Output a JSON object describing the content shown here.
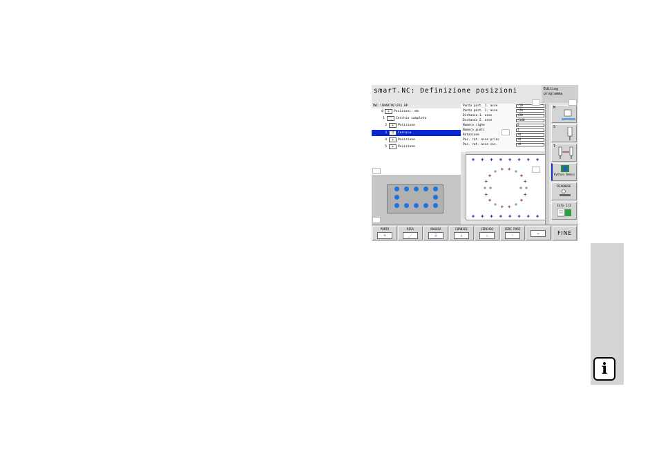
{
  "window": {
    "title": "smarT.NC: Definizione posizioni",
    "mode_line1": "Editing",
    "mode_line2": "programma"
  },
  "file_path": "TNC:\\SMARTNC\\FR1.HP",
  "tree": [
    {
      "num": "0",
      "icon": "+",
      "label": "Posizioni: mm",
      "selected": false
    },
    {
      "num": "1",
      "icon": "∴",
      "label": "Cerchio completo",
      "selected": false
    },
    {
      "num": "2",
      "icon": "+",
      "label": "Posizione",
      "selected": false
    },
    {
      "num": "3",
      "icon": "⠿",
      "label": "Cornice",
      "selected": true
    },
    {
      "num": "4",
      "icon": "+",
      "label": "Posizione",
      "selected": false
    },
    {
      "num": "5",
      "icon": "+",
      "label": "Posizione",
      "selected": false
    }
  ],
  "form": [
    {
      "label": "Punto part. 1. asse",
      "value": "-10"
    },
    {
      "label": "Punto part. 2. asse",
      "value": "-20"
    },
    {
      "label": "Distanza 1. asse",
      "value": "+20"
    },
    {
      "label": "Distanza 2. asse",
      "value": "+140"
    },
    {
      "label": "Numero righe",
      "value": "2"
    },
    {
      "label": "Numero punti",
      "value": "7"
    },
    {
      "label": "Rotazione",
      "value": "+0"
    },
    {
      "label": "Pos. rot. asse princ",
      "value": "+0"
    },
    {
      "label": "Pos. rot. asse sec.",
      "value": "+0"
    }
  ],
  "side_buttons": [
    {
      "key": "M",
      "label": ""
    },
    {
      "key": "S",
      "label": ""
    },
    {
      "key": "T",
      "label": ""
    },
    {
      "key": "",
      "label": "Python Demos"
    },
    {
      "key": "",
      "label": "DIAGNOSE"
    },
    {
      "key": "",
      "label": "Info 1/3"
    }
  ],
  "softkeys": [
    {
      "label": "PUNTO",
      "icon": "+"
    },
    {
      "label": "RIGA",
      "icon": "⋰"
    },
    {
      "label": "RUGOSA",
      "icon": "⠿"
    },
    {
      "label": "CORNICE",
      "icon": "⁞⁞"
    },
    {
      "label": "CERCHIO",
      "icon": "∴"
    },
    {
      "label": "CERC PARZ",
      "icon": "⁖"
    },
    {
      "label": "",
      "icon": "⇔"
    }
  ],
  "end_button": "FINE",
  "info_icon": "i",
  "colors": {
    "selection": "#0a28d0",
    "hole": "#1d74e0",
    "frame_point": "#1a1a80",
    "circle_point": "#8a3a2a"
  }
}
